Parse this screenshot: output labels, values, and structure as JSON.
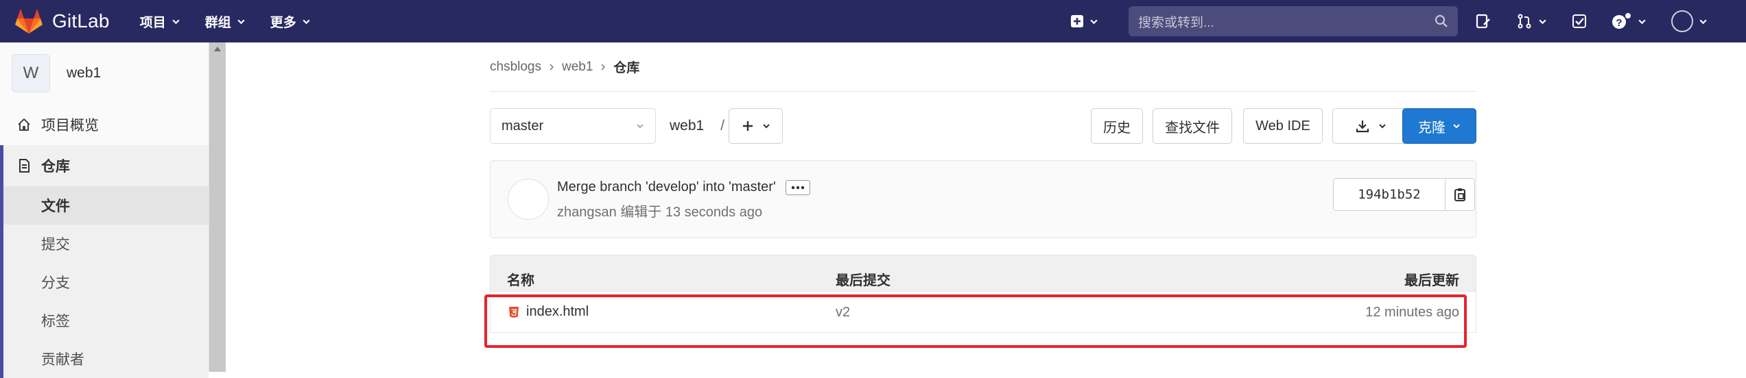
{
  "navbar": {
    "brand": "GitLab",
    "menu": [
      {
        "label": "项目"
      },
      {
        "label": "群组"
      },
      {
        "label": "更多"
      }
    ],
    "search_placeholder": "搜索或转到...",
    "colors": {
      "bg": "#292961",
      "logo": "#e24329"
    }
  },
  "sidebar": {
    "project_initial": "W",
    "project_name": "web1",
    "overview": "项目概览",
    "repository": "仓库",
    "sub_items": [
      "文件",
      "提交",
      "分支",
      "标签",
      "贡献者"
    ]
  },
  "breadcrumb": {
    "items": [
      "chsblogs",
      "web1"
    ],
    "current": "仓库"
  },
  "toolbar": {
    "branch": "master",
    "path_root": "web1",
    "path_sep": "/",
    "history": "历史",
    "find_file": "查找文件",
    "web_ide": "Web IDE",
    "clone": "克隆"
  },
  "last_commit": {
    "message": "Merge branch 'develop' into 'master'",
    "author": "zhangsan",
    "meta": "编辑于 13 seconds ago",
    "sha": "194b1b52"
  },
  "file_table": {
    "headers": {
      "name": "名称",
      "last_commit": "最后提交",
      "last_update": "最后更新"
    },
    "rows": [
      {
        "name": "index.html",
        "commit": "v2",
        "updated": "12 minutes ago"
      }
    ]
  }
}
